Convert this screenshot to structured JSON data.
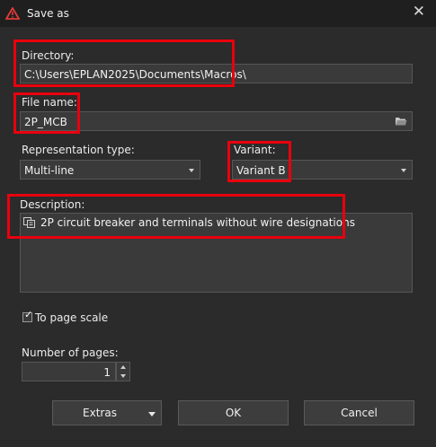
{
  "window": {
    "title": "Save as"
  },
  "directory": {
    "label": "Directory:",
    "value": "C:\\Users\\EPLAN2025\\Documents\\Macros\\"
  },
  "file_name": {
    "label": "File name:",
    "value": "2P_MCB"
  },
  "representation_type": {
    "label": "Representation type:",
    "value": "Multi-line"
  },
  "variant": {
    "label": "Variant:",
    "value": "Variant B"
  },
  "description": {
    "label": "Description:",
    "value": "2P circuit breaker and terminals without wire designations"
  },
  "to_page_scale": {
    "label": "To page scale",
    "checked": true
  },
  "number_of_pages": {
    "label": "Number of pages:",
    "value": "1"
  },
  "buttons": {
    "extras": "Extras",
    "ok": "OK",
    "cancel": "Cancel"
  },
  "colors": {
    "highlight": "#e8000d",
    "background": "#2b2b2b",
    "field": "#3a3a3a"
  }
}
